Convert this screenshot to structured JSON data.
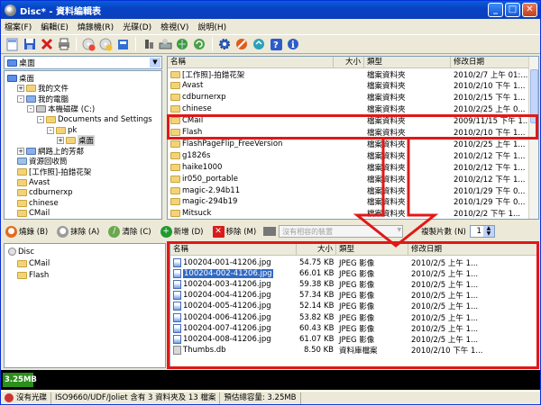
{
  "window": {
    "title": "Disc* - 資料編輯表",
    "min": "_",
    "max": "□",
    "close": "✕"
  },
  "menu": [
    "檔案(F)",
    "編輯(E)",
    "燒錄機(R)",
    "光碟(D)",
    "檢視(V)",
    "說明(H)"
  ],
  "address": {
    "value": "桌面"
  },
  "tree": [
    {
      "label": "桌面",
      "indent": 0,
      "expander": "",
      "kind": "desktop"
    },
    {
      "label": "我的文件",
      "indent": 1,
      "expander": "+",
      "kind": "folder"
    },
    {
      "label": "我的電腦",
      "indent": 1,
      "expander": "-",
      "kind": "computer"
    },
    {
      "label": "本機磁碟 (C:)",
      "indent": 2,
      "expander": "-",
      "kind": "drive"
    },
    {
      "label": "Documents and Settings",
      "indent": 3,
      "expander": "-",
      "kind": "folder"
    },
    {
      "label": "pk",
      "indent": 4,
      "expander": "-",
      "kind": "folder"
    },
    {
      "label": "桌面",
      "indent": 5,
      "expander": "+",
      "kind": "folder",
      "selected": true
    },
    {
      "label": "網路上的芳鄰",
      "indent": 1,
      "expander": "+",
      "kind": "network"
    },
    {
      "label": "資源回收筒",
      "indent": 1,
      "expander": "",
      "kind": "recycle"
    },
    {
      "label": "[工作照]-拍錯花架",
      "indent": 1,
      "expander": "",
      "kind": "folder"
    },
    {
      "label": "Avast",
      "indent": 1,
      "expander": "",
      "kind": "folder"
    },
    {
      "label": "cdburnerxp",
      "indent": 1,
      "expander": "",
      "kind": "folder"
    },
    {
      "label": "chinese",
      "indent": 1,
      "expander": "",
      "kind": "folder"
    },
    {
      "label": "CMail",
      "indent": 1,
      "expander": "",
      "kind": "folder"
    }
  ],
  "file_list": {
    "columns": [
      "名稱",
      "大小",
      "類型",
      "修改日期"
    ],
    "rows": [
      {
        "name": "[工作照]-拍錯花架",
        "size": "",
        "type": "檔案資料夾",
        "date": "2010/2/7 上午 01:..."
      },
      {
        "name": "Avast",
        "size": "",
        "type": "檔案資料夾",
        "date": "2010/2/10 下午 1..."
      },
      {
        "name": "cdburnerxp",
        "size": "",
        "type": "檔案資料夾",
        "date": "2010/2/15 下午 1..."
      },
      {
        "name": "chinese",
        "size": "",
        "type": "檔案資料夾",
        "date": "2010/2/25 上午 0..."
      },
      {
        "name": "CMail",
        "size": "",
        "type": "檔案資料夾",
        "date": "2009/11/15 下午 1..."
      },
      {
        "name": "Flash",
        "size": "",
        "type": "檔案資料夾",
        "date": "2010/2/10 下午 1..."
      },
      {
        "name": "FlashPageFlip_FreeVersion",
        "size": "",
        "type": "檔案資料夾",
        "date": "2010/2/25 上午 1..."
      },
      {
        "name": "g1826s",
        "size": "",
        "type": "檔案資料夾",
        "date": "2010/2/12 下午 1..."
      },
      {
        "name": "haike1000",
        "size": "",
        "type": "檔案資料夾",
        "date": "2010/2/12 下午 1..."
      },
      {
        "name": "ir050_portable",
        "size": "",
        "type": "檔案資料夾",
        "date": "2010/2/12 下午 1..."
      },
      {
        "name": "magic-2.94b11",
        "size": "",
        "type": "檔案資料夾",
        "date": "2010/1/29 下午 0..."
      },
      {
        "name": "magic-294b19",
        "size": "",
        "type": "檔案資料夾",
        "date": "2010/1/29 下午 0..."
      },
      {
        "name": "Mitsuck",
        "size": "",
        "type": "檔案資料夾",
        "date": "2010/2/2 下午 1..."
      }
    ]
  },
  "controls": {
    "burn": "燒錄 (B)",
    "erase": "抹除 (A)",
    "clean": "清除 (C)",
    "add": "新增 (D)",
    "remove": "移除 (M)",
    "device_placeholder": "沒有相容的裝置",
    "copies_label": "複製片數 (N)",
    "copies_value": "1"
  },
  "disc_tree": [
    {
      "label": "Disc",
      "indent": 0,
      "kind": "disc"
    },
    {
      "label": "CMail",
      "indent": 1,
      "kind": "folder"
    },
    {
      "label": "Flash",
      "indent": 1,
      "kind": "folder"
    }
  ],
  "disc_list": {
    "columns": [
      "名稱",
      "大小",
      "類型",
      "修改日期"
    ],
    "rows": [
      {
        "name": "100204-001-41206.jpg",
        "size": "54.75 KB",
        "type": "JPEG 影像",
        "date": "2010/2/5 上午 1..."
      },
      {
        "name": "100204-002-41206.jpg",
        "size": "66.01 KB",
        "type": "JPEG 影像",
        "date": "2010/2/5 上午 1..."
      },
      {
        "name": "100204-003-41206.jpg",
        "size": "59.38 KB",
        "type": "JPEG 影像",
        "date": "2010/2/5 上午 1..."
      },
      {
        "name": "100204-004-41206.jpg",
        "size": "57.34 KB",
        "type": "JPEG 影像",
        "date": "2010/2/5 上午 1..."
      },
      {
        "name": "100204-005-41206.jpg",
        "size": "52.14 KB",
        "type": "JPEG 影像",
        "date": "2010/2/5 上午 1..."
      },
      {
        "name": "100204-006-41206.jpg",
        "size": "53.82 KB",
        "type": "JPEG 影像",
        "date": "2010/2/5 上午 1..."
      },
      {
        "name": "100204-007-41206.jpg",
        "size": "60.43 KB",
        "type": "JPEG 影像",
        "date": "2010/2/5 上午 1..."
      },
      {
        "name": "100204-008-41206.jpg",
        "size": "61.07 KB",
        "type": "JPEG 影像",
        "date": "2010/2/5 上午 1..."
      },
      {
        "name": "Thumbs.db",
        "size": "8.50 KB",
        "type": "資料庫檔案",
        "date": "2010/2/10 下午 1..."
      }
    ]
  },
  "capacity": {
    "label": "3.25MB"
  },
  "status": {
    "disc": "沒有光碟",
    "format": "ISO9660/UDF/Joliet 含有 3 資料夾及 13 檔案",
    "estimate": "預估總容量: 3.25MB"
  },
  "colors": {
    "highlight": "#e01818",
    "selection": "#316ac5",
    "capacity": "#2b8f1a"
  }
}
